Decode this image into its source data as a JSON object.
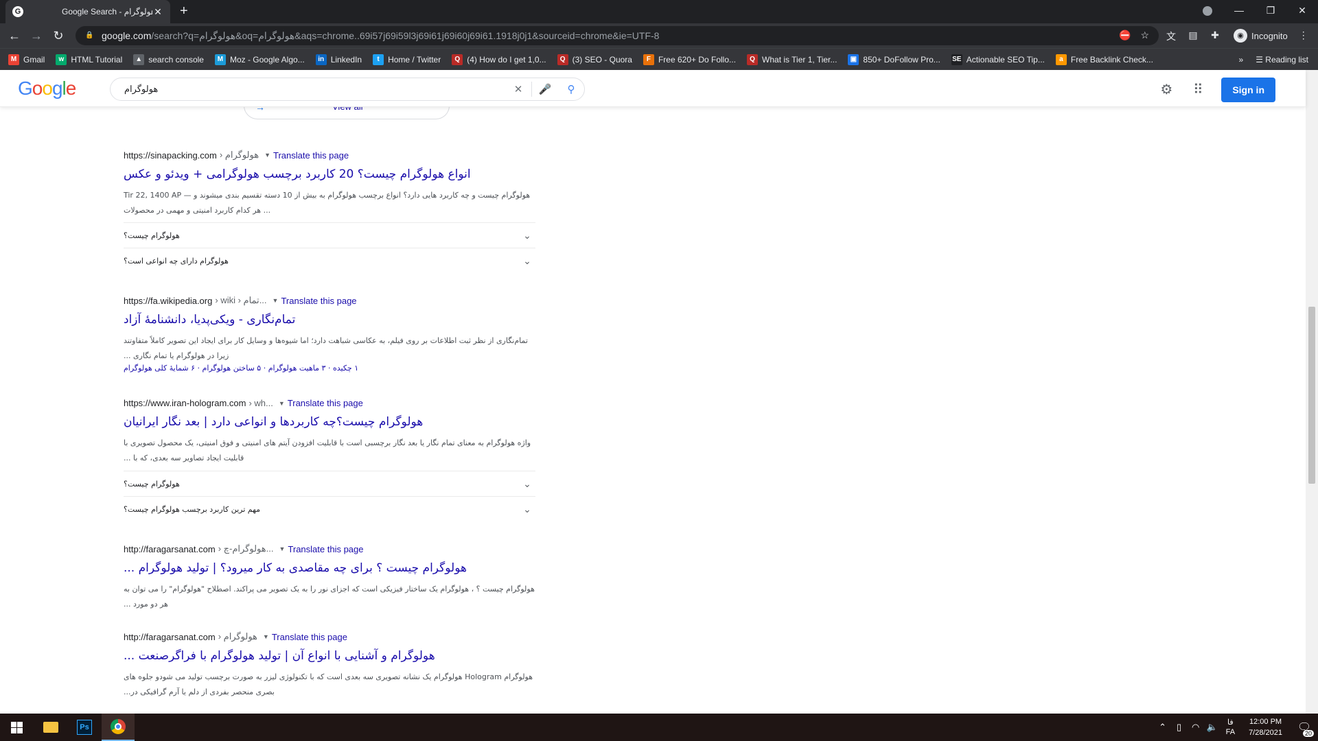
{
  "browser": {
    "tab_title": "Google Search - هولوگرام",
    "tab_favicon": "G",
    "new_tab": "+",
    "url_domain": "google.com",
    "url_rest": "/search?q=هولوگرام&oq=هولوگرام&aqs=chrome..69i57j69i59l3j69i61j69i60j69i61.1918j0j1&sourceid=chrome&ie=UTF-8",
    "incognito_label": "Incognito",
    "reading_list": "Reading list"
  },
  "bookmarks": [
    {
      "label": "Gmail",
      "icon": "M",
      "color": "#ea4335"
    },
    {
      "label": "HTML Tutorial",
      "icon": "w",
      "color": "#04aa6d"
    },
    {
      "label": "search console",
      "icon": "▲",
      "color": "#5f6368"
    },
    {
      "label": "Moz - Google Algo...",
      "icon": "M",
      "color": "#1c9bd8"
    },
    {
      "label": "LinkedIn",
      "icon": "in",
      "color": "#0a66c2"
    },
    {
      "label": "Home / Twitter",
      "icon": "t",
      "color": "#1da1f2"
    },
    {
      "label": "(4) How do I get 1,0...",
      "icon": "Q",
      "color": "#b92b27"
    },
    {
      "label": "(3) SEO - Quora",
      "icon": "Q",
      "color": "#b92b27"
    },
    {
      "label": "Free 620+ Do Follo...",
      "icon": "F",
      "color": "#e8710a"
    },
    {
      "label": "What is Tier 1, Tier...",
      "icon": "Q",
      "color": "#b92b27"
    },
    {
      "label": "850+ DoFollow Pro...",
      "icon": "▣",
      "color": "#1a73e8"
    },
    {
      "label": "Actionable SEO Tip...",
      "icon": "SE",
      "color": "#202124"
    },
    {
      "label": "Free Backlink Check...",
      "icon": "a",
      "color": "#ff9800"
    }
  ],
  "google": {
    "logo": [
      "G",
      "o",
      "o",
      "g",
      "l",
      "e"
    ],
    "logo_colors": [
      "#4285f4",
      "#ea4335",
      "#fbbc05",
      "#4285f4",
      "#34a853",
      "#ea4335"
    ],
    "query": "هولوگرام",
    "sign_in": "Sign in",
    "view_all": "View all"
  },
  "results": [
    {
      "site": "https://sinapacking.com",
      "crumb": "› هولوگرام",
      "translate": "Translate this page",
      "title": "انواع هولوگرام چیست؟ 20 کاربرد برچسب هولوگرامی + ویدئو و عکس",
      "snippet": "Tir 22, 1400 AP — هولوگرام چیست و چه کاربرد هایی دارد؟ انواع برچسب هولوگرام به بیش از 10 دسته تقسیم بندی میشوند و هر کدام کاربرد امنیتی و مهمی در محصولات ...",
      "faqs": [
        "هولوگرام چیست؟",
        "هولوگرام دارای چه انواعی است؟"
      ]
    },
    {
      "site": "https://fa.wikipedia.org",
      "crumb": "› wiki › تمام...",
      "translate": "Translate this page",
      "title": "تمام‌نگاری - ویکی‌پدیا، دانشنامهٔ آزاد",
      "snippet": "تمام‌نگاری از نظر ثبت اطلاعات بر روی فیلم، به عکاسی شباهت دارد؛ اما شیوه‌ها و وسایل کار برای ایجاد این تصویر کاملاً متفاوتند زیرا در هولوگرام یا تمام نگاری ...",
      "links": "۱ چکیده · ۳ ماهیت هولوگرام · ۵ ساختن هولوگرام · ۶ شمایهٔ کلی هولوگرام"
    },
    {
      "site": "https://www.iran-hologram.com",
      "crumb": "› wh...",
      "translate": "Translate this page",
      "title": "هولوگرام چیست؟چه کاربردها و انواعی دارد | بعد نگار ایرانیان",
      "snippet": "واژه هولوگرام به معنای تمام نگار یا بعد نگار برچسبی است با قابلیت افزودن آیتم های امنیتی و فوق امنیتی، یک محصول تصویری با قابلیت ایجاد تصاویر سه بعدی، که با ...",
      "faqs": [
        "هولوگرام چیست؟",
        "مهم ترین کاربرد برچسب هولوگرام چیست؟"
      ]
    },
    {
      "site": "http://faragarsanat.com",
      "crumb": "› هولوگرام-چ...",
      "translate": "Translate this page",
      "title": "هولوگرام چیست ؟ برای چه مقاصدی به کار میرود؟ | تولید هولوگرام ...",
      "snippet": "هولوگرام چیست ؟ ، هولوگرام یک ساختار فیزیکی است که اجزای نور را به یک تصویر می پراکند. اصطلاح \"هولوگرام\" را می توان به هر دو مورد ..."
    },
    {
      "site": "http://faragarsanat.com",
      "crumb": "› هولوگرام",
      "translate": "Translate this page",
      "title": "هولوگرام و آشنایی با انواع آن | تولید هولوگرام با فراگرصنعت ...",
      "snippet": "هولوگرام Hologram هولوگرام یک نشانه تصویری سه بعدی است که با تکنولوژی لیزر به صورت برچسب تولید می شودو جلوه های بصری منحصر بفردی از دلم یا آرم گرافیکی در..."
    }
  ],
  "taskbar": {
    "lang_top": "فا",
    "lang_bottom": "FA",
    "time": "12:00 PM",
    "date": "7/28/2021",
    "notif_count": "20"
  }
}
